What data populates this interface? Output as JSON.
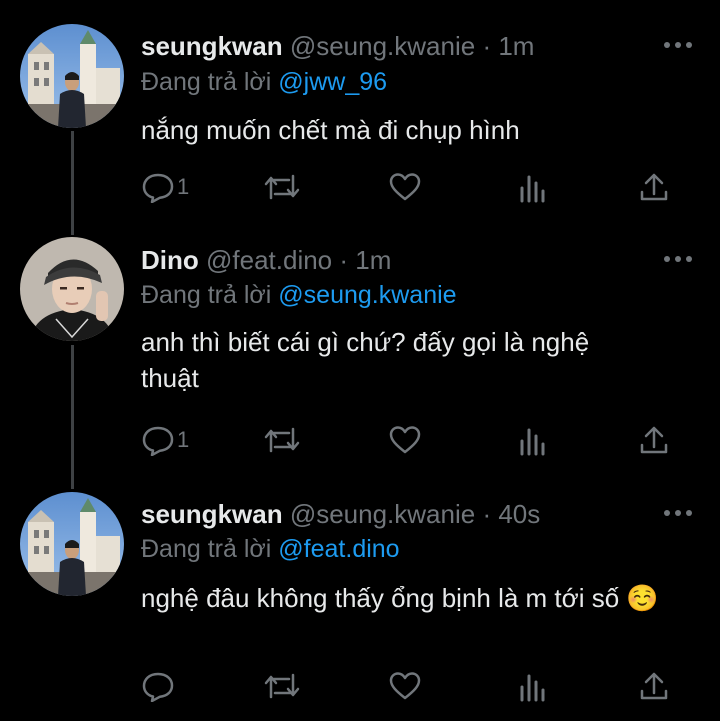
{
  "tweets": [
    {
      "display_name": "seungkwan",
      "handle": "@seung.kwanie",
      "time": "1m",
      "reply_prefix": "Đang trả lời",
      "reply_to": "@jww_96",
      "text": "nắng muốn chết mà đi chụp hình",
      "reply_count": "1",
      "avatar": "seungkwan-avatar"
    },
    {
      "display_name": "Dino",
      "handle": "@feat.dino",
      "time": "1m",
      "reply_prefix": "Đang trả lời",
      "reply_to": "@seung.kwanie",
      "text": "anh thì biết cái gì chứ? đấy gọi là nghệ thuật",
      "reply_count": "1",
      "avatar": "dino-avatar"
    },
    {
      "display_name": "seungkwan",
      "handle": "@seung.kwanie",
      "time": "40s",
      "reply_prefix": "Đang trả lời",
      "reply_to": "@feat.dino",
      "text": "nghệ đâu không thấy ổng bịnh là m tới số ☺️",
      "reply_count": "",
      "avatar": "seungkwan-avatar"
    }
  ],
  "icons": [
    "reply-icon",
    "retweet-icon",
    "like-icon",
    "analytics-icon",
    "share-icon",
    "more-icon"
  ],
  "colors": {
    "background": "#000000",
    "text": "#e7e9ea",
    "secondary": "#71767b",
    "accent": "#1d9bf0",
    "thread_line": "#3e4144"
  }
}
